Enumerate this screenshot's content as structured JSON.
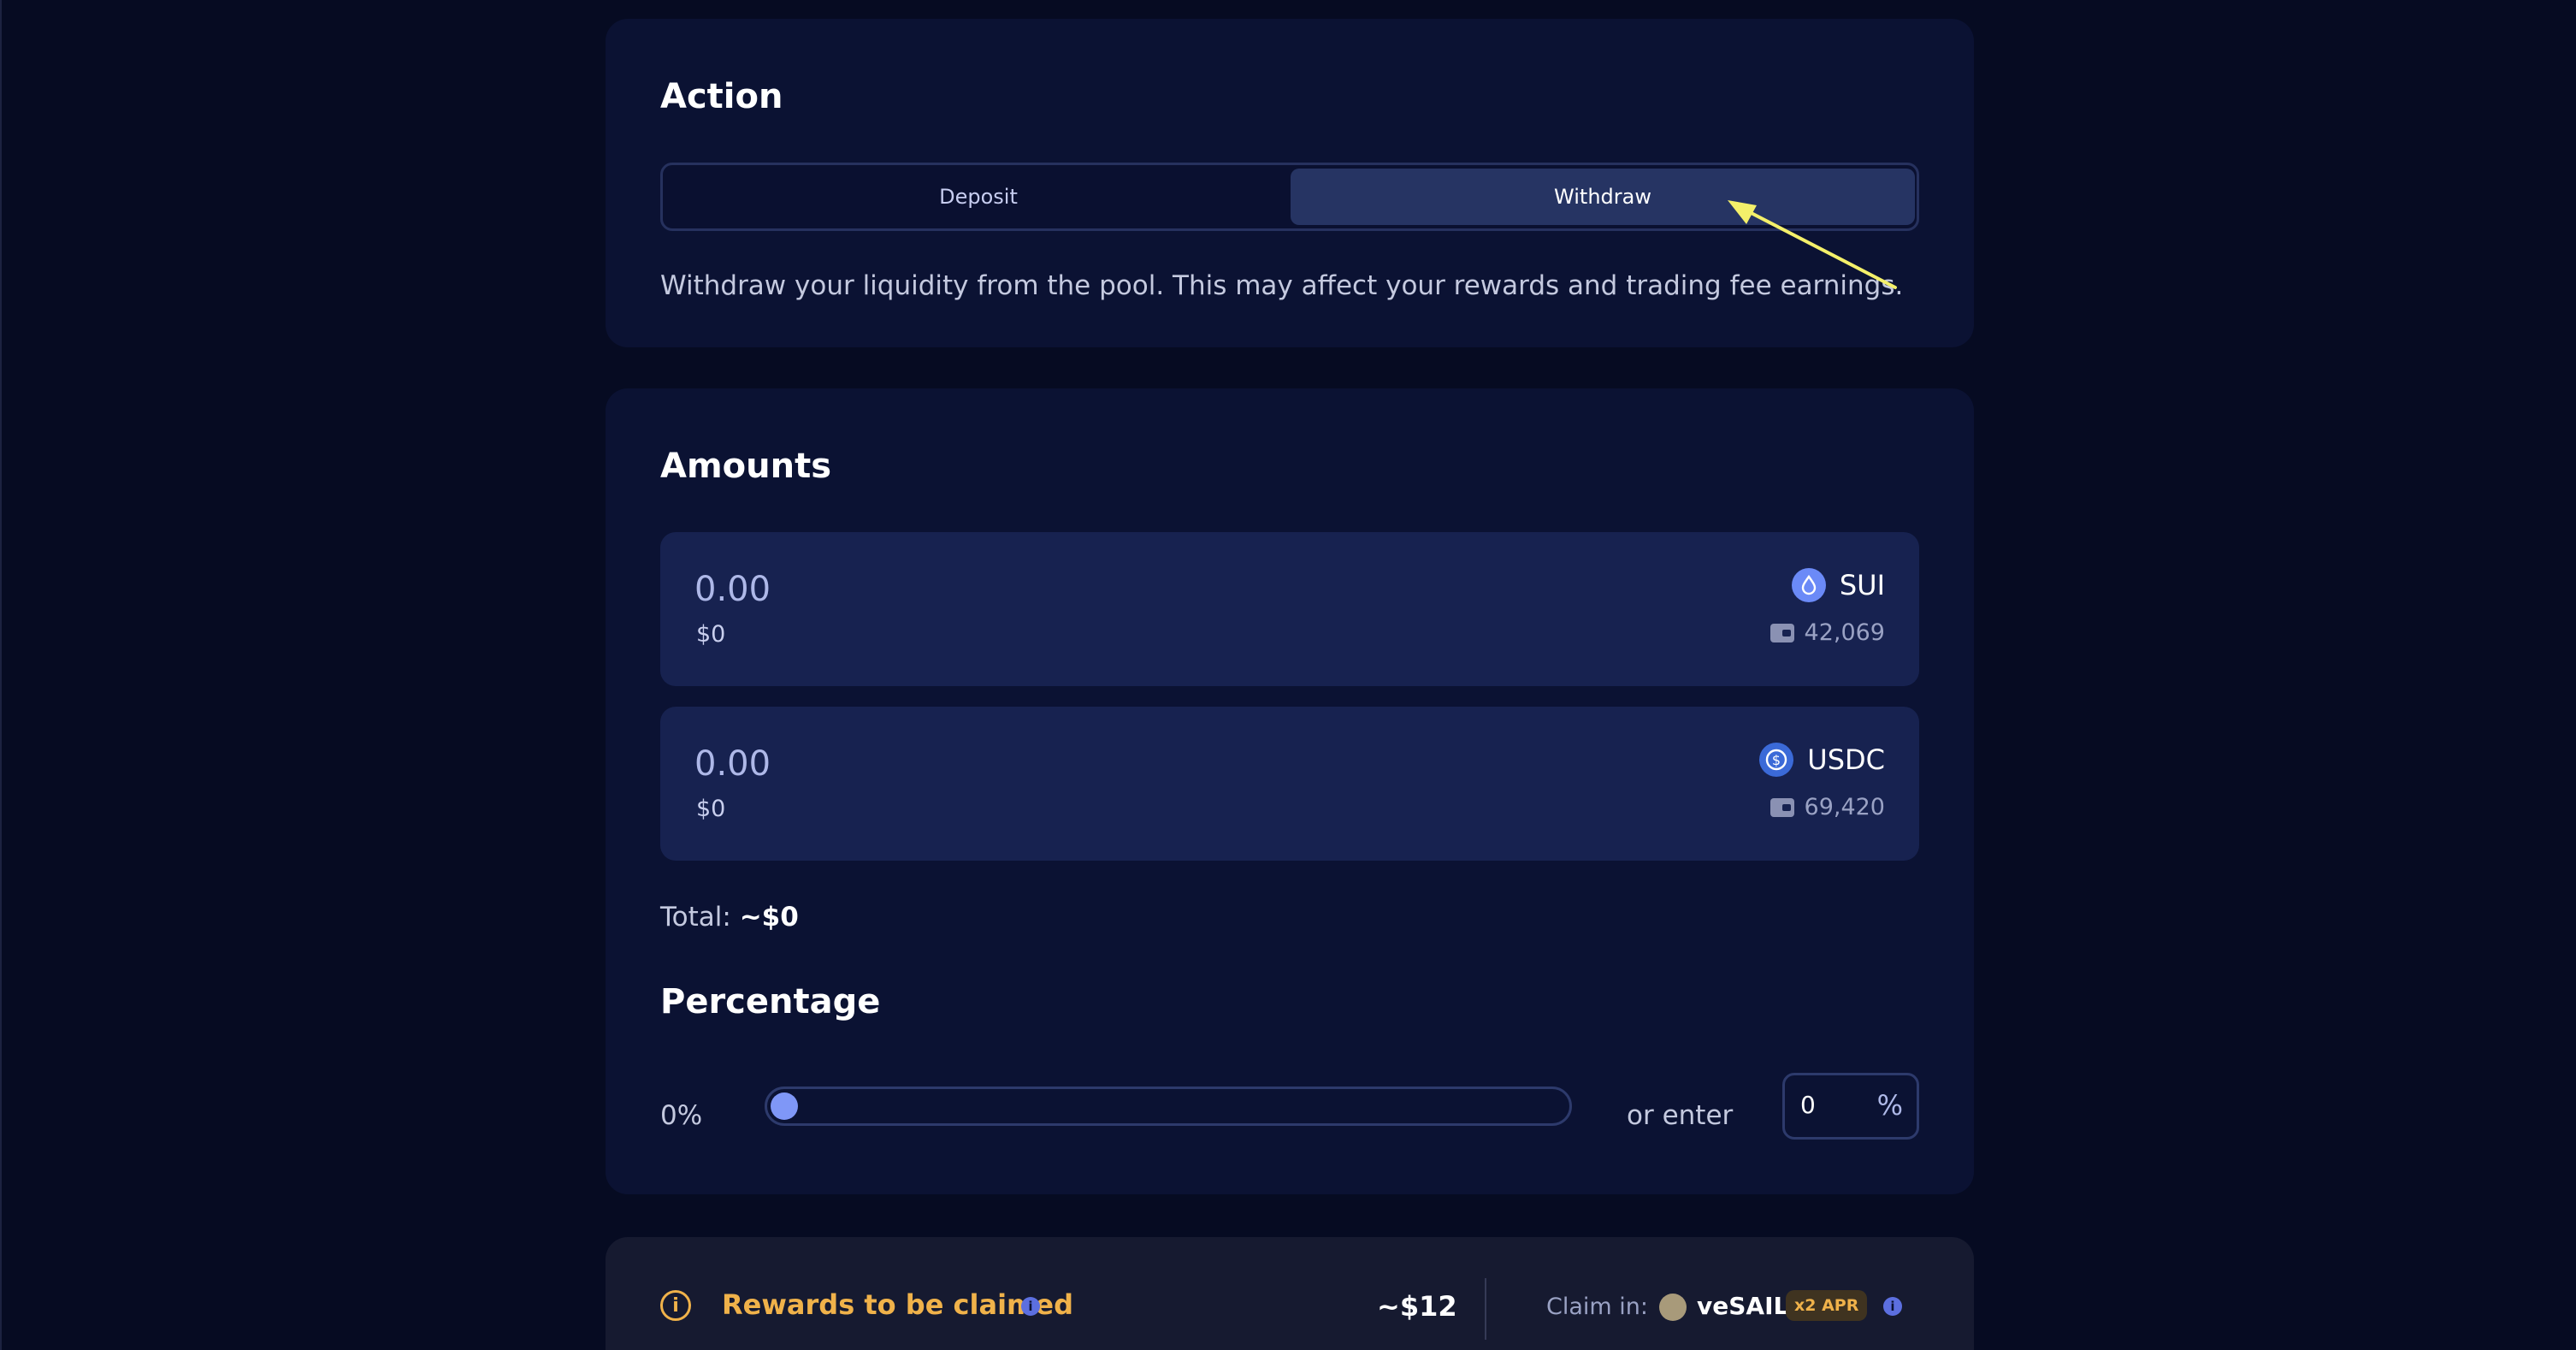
{
  "action": {
    "title": "Action",
    "tabs": {
      "deposit": "Deposit",
      "withdraw": "Withdraw"
    },
    "active_tab": "withdraw",
    "description": "Withdraw your liquidity from the pool. This may affect your rewards and trading fee earnings."
  },
  "amounts": {
    "title": "Amounts",
    "tokens": [
      {
        "symbol": "SUI",
        "value": "0.00",
        "usd": "$0",
        "balance": "42,069"
      },
      {
        "symbol": "USDC",
        "value": "0.00",
        "usd": "$0",
        "balance": "69,420"
      }
    ],
    "total_label": "Total:",
    "total_value": "~$0"
  },
  "percentage": {
    "title": "Percentage",
    "value_label": "0%",
    "slider_value": 0,
    "or_enter": "or enter",
    "input_value": "0",
    "unit": "%"
  },
  "rewards": {
    "title": "Rewards to be claimed",
    "amount": "~$12",
    "claim_label": "Claim in:",
    "token": "veSAIL",
    "badge": "x2 APR"
  },
  "colors": {
    "background": "#060b22",
    "card": "#0b1233",
    "active_tab": "#263463",
    "accent": "#7f97f7",
    "rewards": "#f0b24a",
    "annotation_arrow": "#f4f06a"
  }
}
